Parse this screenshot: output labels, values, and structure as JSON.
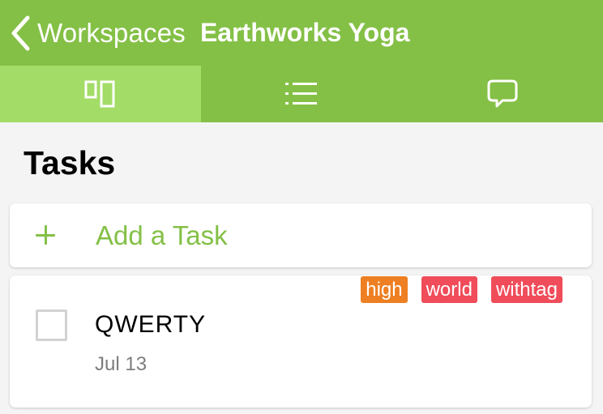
{
  "navbar": {
    "back_label": "Workspaces",
    "title": "Earthworks Yoga",
    "back_icon": "chevron-left-icon",
    "background": "#84c046"
  },
  "tabs": [
    {
      "icon": "board-icon",
      "active": true
    },
    {
      "icon": "list-icon",
      "active": false
    },
    {
      "icon": "chat-bubble-icon",
      "active": false
    }
  ],
  "main": {
    "section_title": "Tasks",
    "add_task_label": "Add a Task",
    "accent_color": "#84c046"
  },
  "task": {
    "name": "QWERTY",
    "date": "Jul 13",
    "completed": false,
    "tags": [
      {
        "label": "high",
        "color": "#ee7f22"
      },
      {
        "label": "world",
        "color": "#f04c5a"
      },
      {
        "label": "withtag",
        "color": "#f04c5a"
      }
    ]
  }
}
